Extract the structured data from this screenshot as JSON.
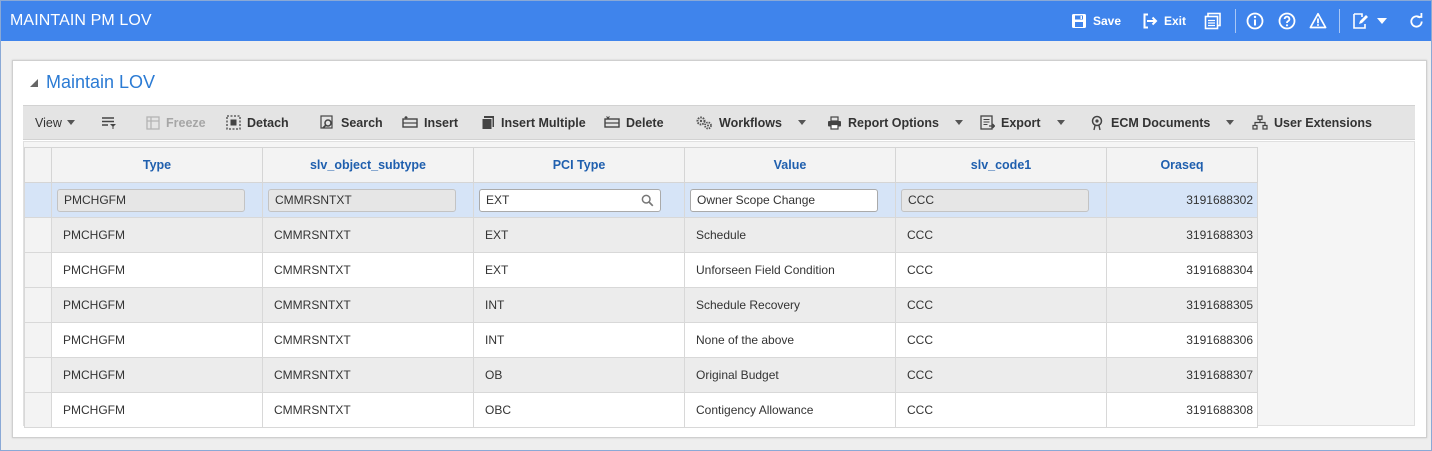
{
  "app": {
    "title": "MAINTAIN PM LOV",
    "header_actions": {
      "save_label": "Save",
      "exit_label": "Exit"
    }
  },
  "panel": {
    "title": "Maintain LOV"
  },
  "toolbar": {
    "view_label": "View",
    "freeze_label": "Freeze",
    "detach_label": "Detach",
    "search_label": "Search",
    "insert_label": "Insert",
    "insert_multiple_label": "Insert Multiple",
    "delete_label": "Delete",
    "workflows_label": "Workflows",
    "report_options_label": "Report Options",
    "export_label": "Export",
    "ecm_documents_label": "ECM Documents",
    "user_extensions_label": "User Extensions"
  },
  "grid": {
    "columns": [
      "Type",
      "slv_object_subtype",
      "PCI Type",
      "Value",
      "slv_code1",
      "Oraseq"
    ],
    "rows": [
      {
        "type": "PMCHGFM",
        "subtype": "CMMRSNTXT",
        "pci_type": "EXT",
        "value": "Owner Scope Change",
        "code1": "CCC",
        "oraseq": "3191688302"
      },
      {
        "type": "PMCHGFM",
        "subtype": "CMMRSNTXT",
        "pci_type": "EXT",
        "value": "Schedule",
        "code1": "CCC",
        "oraseq": "3191688303"
      },
      {
        "type": "PMCHGFM",
        "subtype": "CMMRSNTXT",
        "pci_type": "EXT",
        "value": "Unforseen Field Condition",
        "code1": "CCC",
        "oraseq": "3191688304"
      },
      {
        "type": "PMCHGFM",
        "subtype": "CMMRSNTXT",
        "pci_type": "INT",
        "value": "Schedule Recovery",
        "code1": "CCC",
        "oraseq": "3191688305"
      },
      {
        "type": "PMCHGFM",
        "subtype": "CMMRSNTXT",
        "pci_type": "INT",
        "value": "None of the above",
        "code1": "CCC",
        "oraseq": "3191688306"
      },
      {
        "type": "PMCHGFM",
        "subtype": "CMMRSNTXT",
        "pci_type": "OB",
        "value": "Original Budget",
        "code1": "CCC",
        "oraseq": "3191688307"
      },
      {
        "type": "PMCHGFM",
        "subtype": "CMMRSNTXT",
        "pci_type": "OBC",
        "value": "Contigency Allowance",
        "code1": "CCC",
        "oraseq": "3191688308"
      }
    ]
  },
  "colors": {
    "header_bg": "#3f84ec",
    "panel_title": "#2b7bd4",
    "column_header_text": "#1f5fae",
    "active_row": "#d6e4f7"
  }
}
